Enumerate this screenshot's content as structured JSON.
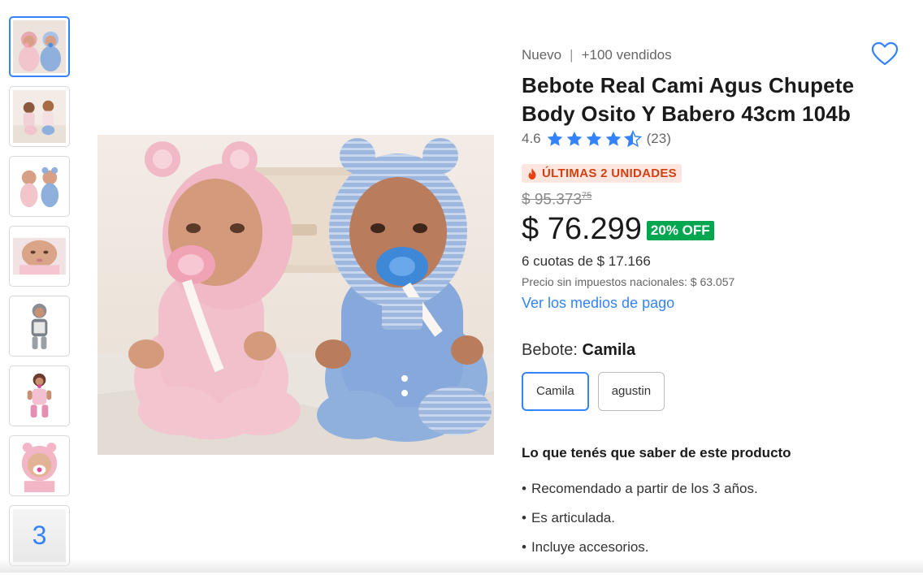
{
  "gallery": {
    "thumbnails": [
      "thumb-1",
      "thumb-2",
      "thumb-3",
      "thumb-4",
      "thumb-5",
      "thumb-6",
      "thumb-7"
    ],
    "more_count": "3"
  },
  "product": {
    "condition": "Nuevo",
    "separator": "|",
    "sold": "+100 vendidos",
    "title": "Bebote Real Cami Agus Chupete Body Osito Y Babero 43cm 104b",
    "rating_value": "4.6",
    "rating_count": "(23)",
    "rating_stars": 4.5,
    "stock_badge": "ÚLTIMAS 2 UNIDADES",
    "old_price": "$ 95.373",
    "old_price_cents": "75",
    "price": "$ 76.299",
    "discount": "20% OFF",
    "installments": "6 cuotas de $ 17.166",
    "tax_note": "Precio sin impuestos nacionales: $ 63.057",
    "payment_link": "Ver los medios de pago"
  },
  "variant": {
    "label": "Bebote: ",
    "selected": "Camila",
    "options": [
      "Camila",
      "agustin"
    ]
  },
  "highlights": {
    "title": "Lo que tenés que saber de este producto",
    "items": [
      "Recomendado a partir de los 3 años.",
      "Es articulada.",
      "Incluye accesorios."
    ]
  },
  "colors": {
    "accent": "#3483fa",
    "discount": "#00a650",
    "badge_text": "#d43f0f",
    "badge_bg": "#fde6e0"
  },
  "icons": [
    "heart-icon",
    "star-icon",
    "star-half-icon",
    "fire-icon"
  ]
}
